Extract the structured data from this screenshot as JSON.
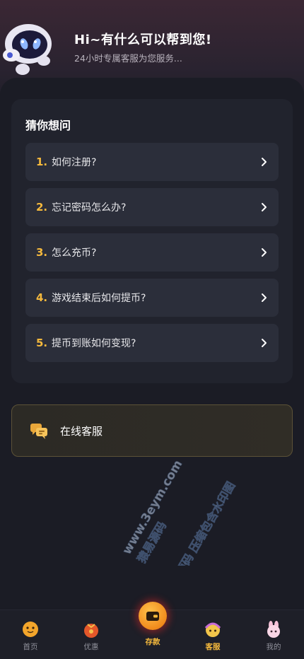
{
  "header": {
    "title": "Hi~有什么可以帮到您!",
    "subtitle": "24小时专属客服为您服务..."
  },
  "faq": {
    "title": "猜你想问",
    "items": [
      {
        "num": "1.",
        "text": "如何注册?"
      },
      {
        "num": "2.",
        "text": "忘记密码怎么办?"
      },
      {
        "num": "3.",
        "text": "怎么充币?"
      },
      {
        "num": "4.",
        "text": "游戏结束后如何提币?"
      },
      {
        "num": "5.",
        "text": "提币到账如何变现?"
      }
    ]
  },
  "service": {
    "label": "在线客服",
    "icon": "chat-bubbles-icon"
  },
  "watermark": {
    "line1": "www.3eym.com",
    "line2": "猿易源码",
    "line3": "猿易源码 压缩包含水印图"
  },
  "tabbar": {
    "tabs": [
      {
        "label": "首页",
        "icon": "home-ball-icon",
        "active": false
      },
      {
        "label": "优惠",
        "icon": "gift-bag-icon",
        "active": false
      },
      {
        "label": "存款",
        "icon": "wallet-icon",
        "active": true
      },
      {
        "label": "客服",
        "icon": "support-mascot-icon",
        "active": true
      },
      {
        "label": "我的",
        "icon": "bunny-icon",
        "active": false
      }
    ]
  },
  "colors": {
    "accent": "#f5b93d",
    "background": "#1b1c25",
    "card": "#21232d",
    "item": "#2b2e3a"
  }
}
